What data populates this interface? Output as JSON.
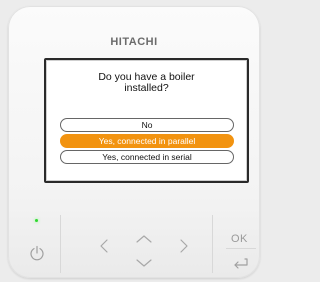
{
  "brand": "HITACHI",
  "dialog": {
    "question_line1": "Do you have a boiler",
    "question_line2": "installed?",
    "options": [
      {
        "label": "No",
        "selected": false
      },
      {
        "label": "Yes, connected in parallel",
        "selected": true
      },
      {
        "label": "Yes, connected in serial",
        "selected": false
      }
    ]
  },
  "controls": {
    "ok_label": "OK",
    "power_icon": "power-icon",
    "left_icon": "chevron-left-icon",
    "up_icon": "chevron-up-icon",
    "down_icon": "chevron-down-icon",
    "right_icon": "chevron-right-icon",
    "back_icon": "return-arrow-icon"
  },
  "colors": {
    "selected_option": "#f29310",
    "status_led": "#2fd82f"
  }
}
